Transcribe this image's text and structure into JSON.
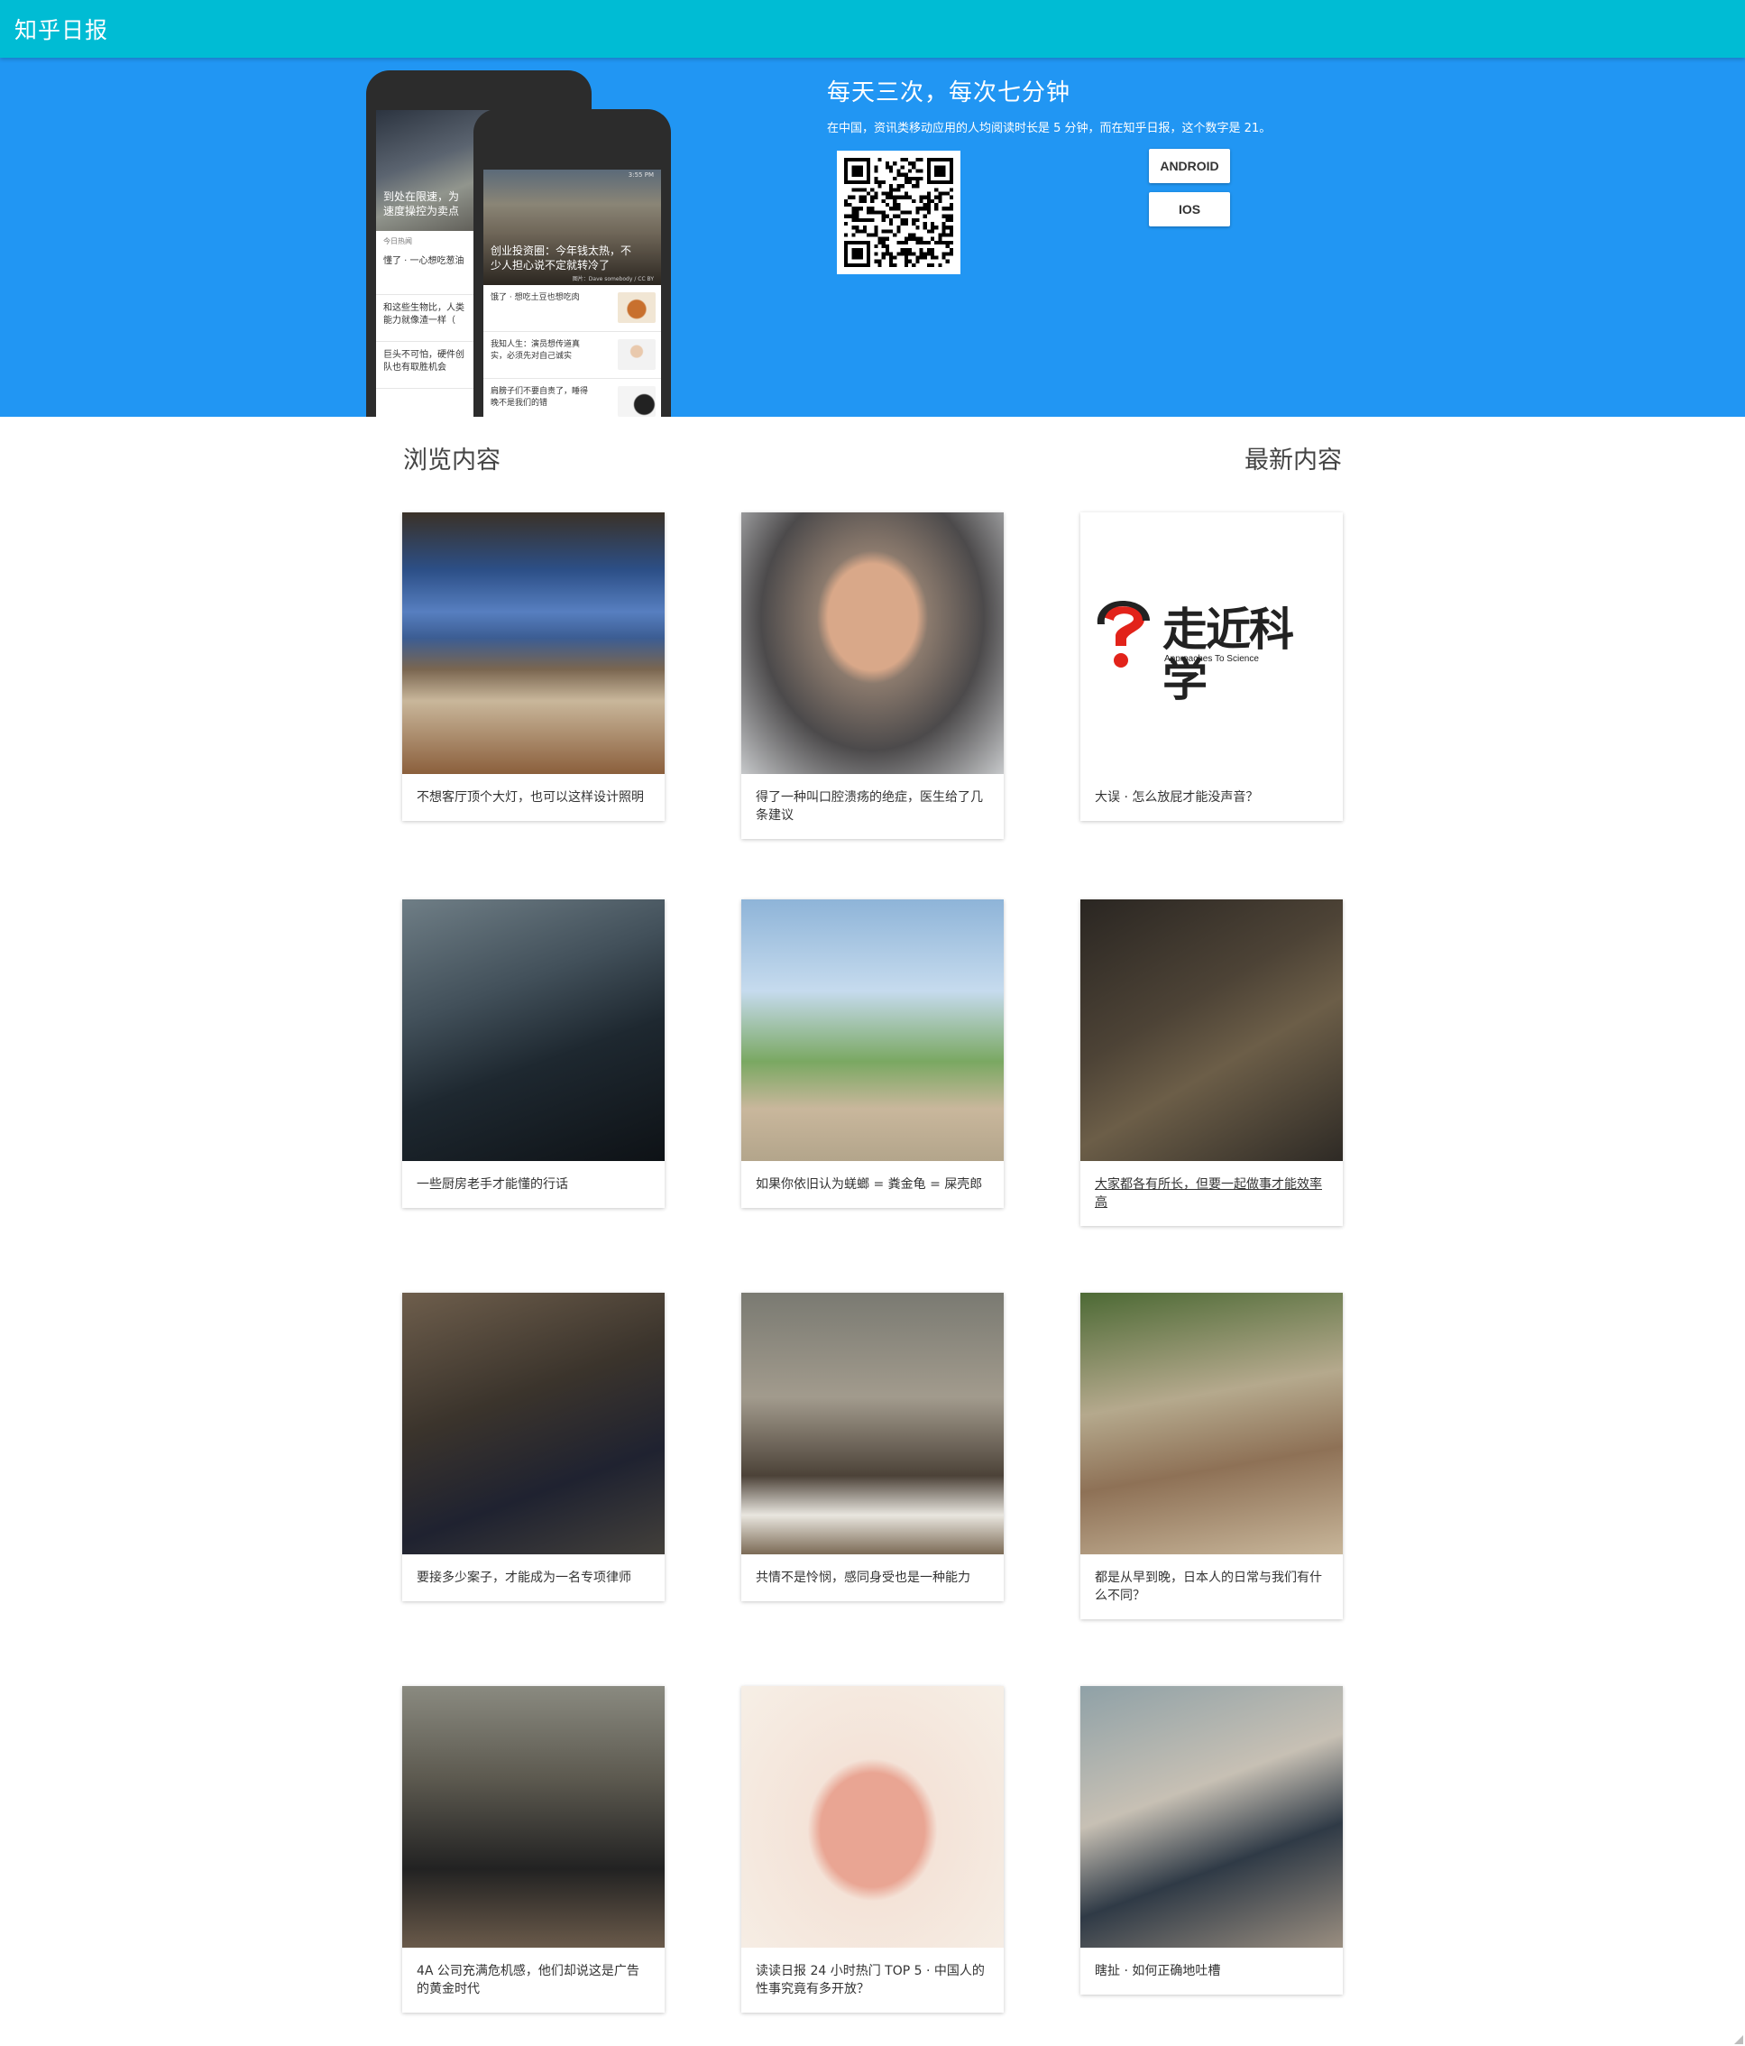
{
  "header": {
    "brand": "知乎日报"
  },
  "hero": {
    "title": "每天三次，每次七分钟",
    "subtitle": "在中国，资讯类移动应用的人均阅读时长是 5 分钟，而在知乎日报，这个数字是 21。",
    "android_label": "ANDROID",
    "ios_label": "IOS",
    "phone_back": {
      "hero_caption": "到处在限速，为\n速度操控为卖点",
      "section": "今日热闻",
      "items": [
        "懂了 · 一心想吃葱油",
        "和这些生物比，人类\n能力就像渣一样（",
        "巨头不可怕，硬件创\n队也有取胜机会"
      ]
    },
    "phone_front": {
      "status": "3:55 PM",
      "hero_caption": "创业投资圈：今年钱太热，不\n少人担心说不定就转冷了",
      "hero_meta": "图片：Dave somebody / CC BY",
      "items": [
        "饿了 · 想吃土豆也想吃肉",
        "我知人生：演员想传道真\n实，必须先对自己诚实",
        "肩膀子们不要自责了，睡得\n晚不是我们的错"
      ]
    }
  },
  "sections": {
    "browse": "浏览内容",
    "latest": "最新内容"
  },
  "logo": {
    "text": "走近科学",
    "sub": "Approaches To Science"
  },
  "cards": [
    {
      "title": "不想客厅顶个大灯，也可以这样设计照明"
    },
    {
      "title": "得了一种叫口腔溃疡的绝症，医生给了几条建议"
    },
    {
      "title": "大误 · 怎么放屁才能没声音？"
    },
    {
      "title": "一些厨房老手才能懂的行话"
    },
    {
      "title": "如果你依旧认为蜣螂 = 粪金龟 = 屎壳郎"
    },
    {
      "title": "大家都各有所长，但要一起做事才能效率高"
    },
    {
      "title": "要接多少案子，才能成为一名专项律师"
    },
    {
      "title": "共情不是怜悯，感同身受也是一种能力"
    },
    {
      "title": "都是从早到晚，日本人的日常与我们有什么不同？"
    },
    {
      "title": "4A 公司充满危机感，他们却说这是广告的黄金时代"
    },
    {
      "title": "读读日报 24 小时热门 TOP 5 · 中国人的性事究竟有多开放？"
    },
    {
      "title": "瞎扯 · 如何正确地吐槽"
    }
  ],
  "colors": {
    "topbar": "#00bcd4",
    "hero": "#2196f3",
    "logo_red": "#e2231a"
  }
}
